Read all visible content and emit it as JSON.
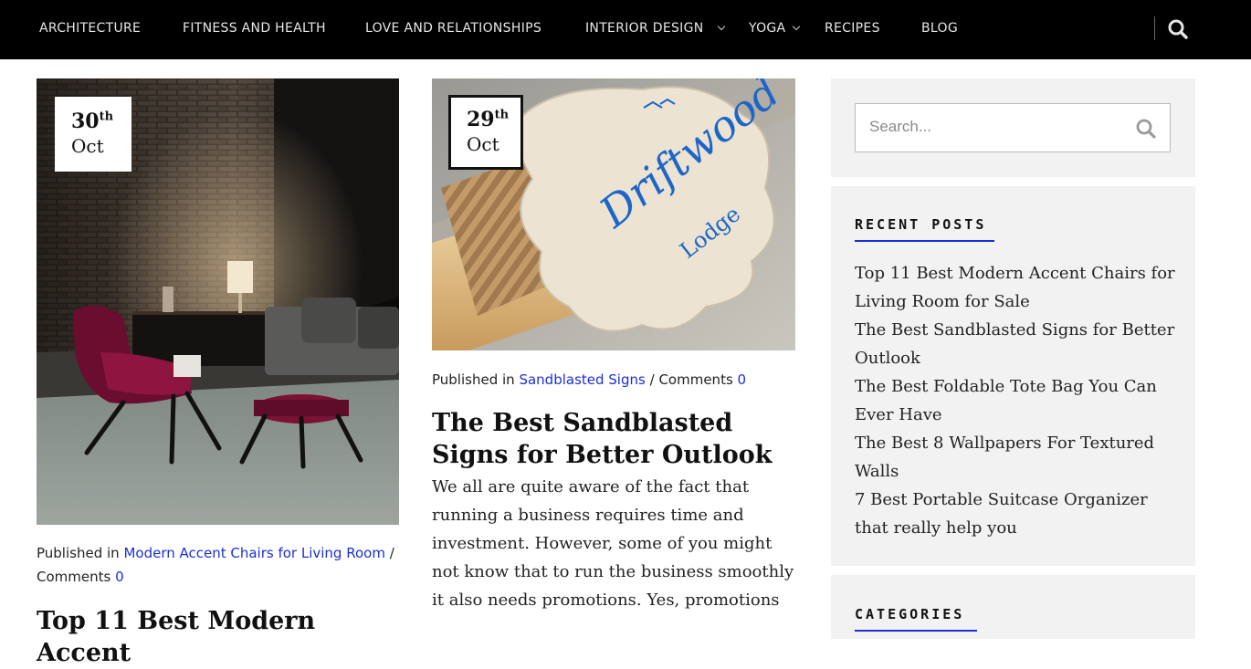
{
  "nav": {
    "items": [
      {
        "label": "ARCHITECTURE",
        "has_dropdown": false
      },
      {
        "label": "FITNESS AND HEALTH",
        "has_dropdown": false
      },
      {
        "label": "LOVE AND RELATIONSHIPS",
        "has_dropdown": false
      },
      {
        "label": "INTERIOR DESIGN",
        "has_dropdown": true
      },
      {
        "label": "YOGA",
        "has_dropdown": true
      },
      {
        "label": "RECIPES",
        "has_dropdown": false
      },
      {
        "label": "BLOG",
        "has_dropdown": false
      }
    ],
    "search_icon": "search-icon"
  },
  "posts": [
    {
      "date_day": "30",
      "date_suffix": "th",
      "date_month": "Oct",
      "meta_prefix": "Published in",
      "category": "Modern Accent Chairs for Living Room",
      "separator": "/",
      "comments_label": "Comments",
      "comments_count": "0",
      "title": "Top 11 Best Modern Accent"
    },
    {
      "date_day": "29",
      "date_suffix": "th",
      "date_month": "Oct",
      "meta_prefix": "Published in",
      "category": "Sandblasted Signs",
      "separator": "/",
      "comments_label": "Comments",
      "comments_count": "0",
      "title": "The Best Sandblasted Signs for Better Outlook",
      "excerpt": "We all are quite aware of the fact that running a business requires time and investment. However, some of you might not know that to run the business smoothly it also needs promotions. Yes, promotions",
      "sign_text": [
        "Driftwood",
        "Lodge"
      ]
    }
  ],
  "sidebar": {
    "search": {
      "placeholder": "Search..."
    },
    "recent_posts": {
      "title": "RECENT POSTS",
      "items": [
        "Top 11 Best Modern Accent Chairs for Living Room for Sale",
        "The Best Sandblasted Signs for Better Outlook",
        "The Best Foldable Tote Bag You Can Ever Have",
        "The Best 8 Wallpapers For Textured Walls",
        "7 Best Portable Suitcase Organizer that really help you"
      ]
    },
    "categories": {
      "title": "CATEGORIES"
    }
  },
  "colors": {
    "nav_bg": "#000000",
    "link": "#1a2fd6",
    "widget_bg": "#f2f2f2",
    "accent": "#1a2fd6"
  }
}
